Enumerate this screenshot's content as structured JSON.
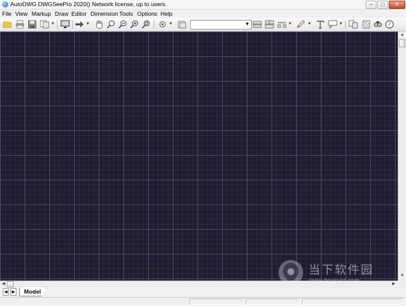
{
  "window": {
    "title": "AutoDWG DWGSeePro 2020() Network license, up to  users.",
    "min_glyph": "‒",
    "max_glyph": "□",
    "close_glyph": "✕"
  },
  "menu": [
    "File",
    "View",
    "Markup",
    "Draw",
    "Editor",
    "Dimension",
    "Tools",
    "Options",
    "Help"
  ],
  "toolbar": {
    "icons": [
      "open-folder-icon",
      "print-icon",
      "save-icon",
      "batch-convert-icon",
      "monitor-icon",
      "arrow-right-icon",
      "pan-hand-icon",
      "zoom-realtime-icon",
      "zoom-out-icon",
      "zoom-in-icon",
      "zoom-window-icon",
      "layer-manager-icon",
      "layer-toggle-icon",
      "layout-1-icon",
      "layout-2-icon",
      "layout-3-icon",
      "pen-icon",
      "text-icon",
      "callout-icon",
      "compare-icon",
      "hatch-icon",
      "find-icon",
      "help-icon"
    ],
    "layer_dropdown_value": ""
  },
  "colors": {
    "canvas_background": "#1f1c30",
    "grid_major": "#5a5680",
    "grid_minor": "#38344f"
  },
  "tabs": {
    "model_label": "Model"
  },
  "watermark": {
    "name": "当下软件园",
    "url": "www.downxia.com"
  }
}
